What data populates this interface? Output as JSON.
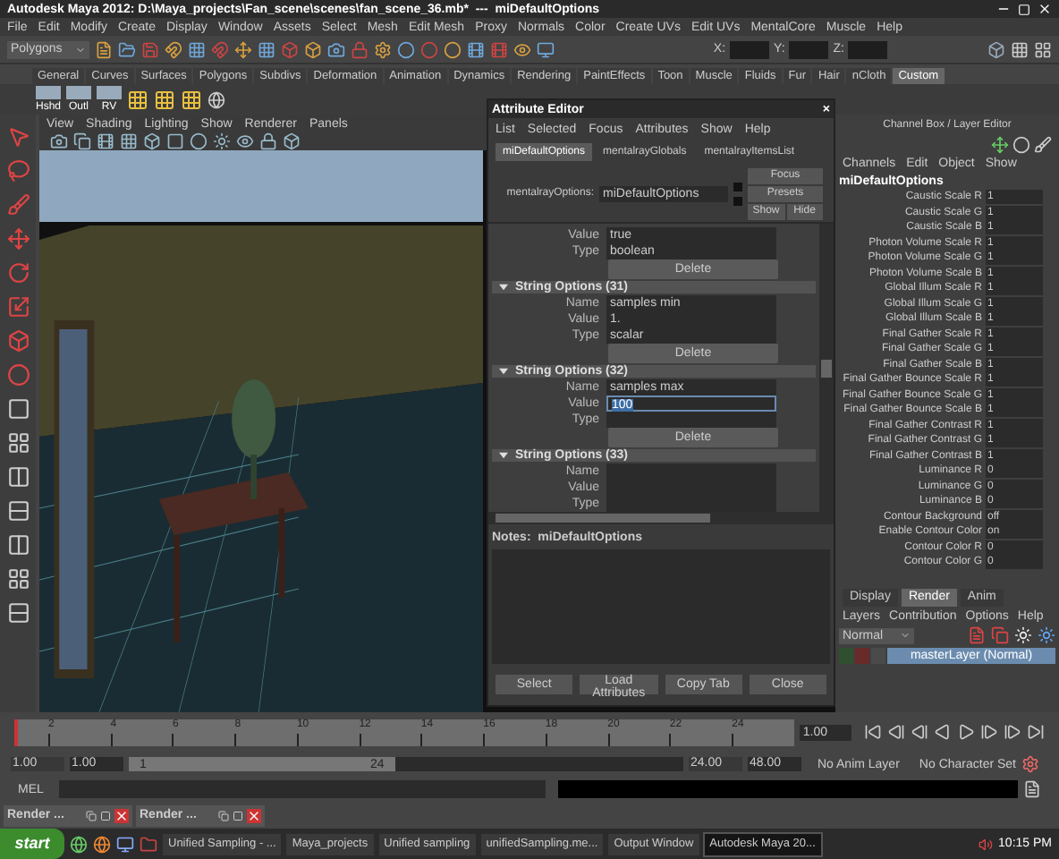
{
  "window": {
    "title": "Autodesk Maya 2012: D:\\Maya_projects\\Fan_scene\\scenes\\fan_scene_36.mb*  ---  miDefaultOptions"
  },
  "menu_bar": [
    "File",
    "Edit",
    "Modify",
    "Create",
    "Display",
    "Window",
    "Assets",
    "Select",
    "Mesh",
    "Edit Mesh",
    "Proxy",
    "Normals",
    "Color",
    "Create UVs",
    "Edit UVs",
    "MentalCore",
    "Muscle",
    "Help"
  ],
  "status_line": {
    "mode": "Polygons",
    "coord_labels": [
      "X:",
      "Y:",
      "Z:"
    ]
  },
  "shelf_tabs": [
    {
      "label": "General",
      "selected": false
    },
    {
      "label": "Curves",
      "selected": false
    },
    {
      "label": "Surfaces",
      "selected": false
    },
    {
      "label": "Polygons",
      "selected": false
    },
    {
      "label": "Subdivs",
      "selected": false
    },
    {
      "label": "Deformation",
      "selected": false
    },
    {
      "label": "Animation",
      "selected": false
    },
    {
      "label": "Dynamics",
      "selected": false
    },
    {
      "label": "Rendering",
      "selected": false
    },
    {
      "label": "PaintEffects",
      "selected": false
    },
    {
      "label": "Toon",
      "selected": false
    },
    {
      "label": "Muscle",
      "selected": false
    },
    {
      "label": "Fluids",
      "selected": false
    },
    {
      "label": "Fur",
      "selected": false
    },
    {
      "label": "Hair",
      "selected": false
    },
    {
      "label": "nCloth",
      "selected": false
    },
    {
      "label": "Custom",
      "selected": true
    }
  ],
  "shelf_buttons": [
    "Hshd",
    "Outl",
    "RV"
  ],
  "viewport": {
    "menu": [
      "View",
      "Shading",
      "Lighting",
      "Show",
      "Renderer",
      "Panels"
    ]
  },
  "attribute_editor": {
    "title": "Attribute Editor",
    "close": "×",
    "menu": [
      "List",
      "Selected",
      "Focus",
      "Attributes",
      "Show",
      "Help"
    ],
    "tabs": [
      {
        "label": "miDefaultOptions",
        "selected": true
      },
      {
        "label": "mentalrayGlobals",
        "selected": false
      },
      {
        "label": "mentalrayItemsList",
        "selected": false
      }
    ],
    "node_label": "mentalrayOptions:",
    "node_name": "miDefaultOptions",
    "side_buttons": [
      "Focus",
      "Presets",
      "Show",
      "Hide"
    ],
    "rows": [
      {
        "kind": "field",
        "label": "Value",
        "value": "true",
        "selected": false
      },
      {
        "kind": "field",
        "label": "Type",
        "value": "boolean",
        "selected": false
      },
      {
        "kind": "button",
        "label": "Delete"
      },
      {
        "kind": "header",
        "label": "String Options (31)",
        "expanded": true
      },
      {
        "kind": "field",
        "label": "Name",
        "value": "samples min",
        "selected": false
      },
      {
        "kind": "field",
        "label": "Value",
        "value": "1.",
        "selected": false
      },
      {
        "kind": "field",
        "label": "Type",
        "value": "scalar",
        "selected": false
      },
      {
        "kind": "button",
        "label": "Delete"
      },
      {
        "kind": "header",
        "label": "String Options (32)",
        "expanded": true
      },
      {
        "kind": "field",
        "label": "Name",
        "value": "samples max",
        "selected": false
      },
      {
        "kind": "field",
        "label": "Value",
        "value": "100",
        "selected": true
      },
      {
        "kind": "field",
        "label": "Type",
        "selected": false
      },
      {
        "kind": "button",
        "label": "Delete"
      },
      {
        "kind": "header",
        "label": "String Options (33)",
        "expanded": true
      },
      {
        "kind": "field",
        "label": "Name",
        "selected": false
      },
      {
        "kind": "field",
        "label": "Value",
        "selected": false
      },
      {
        "kind": "field",
        "label": "Type",
        "selected": false
      }
    ],
    "notes_label": "Notes:  miDefaultOptions",
    "buttons": [
      "Select",
      "Load Attributes",
      "Copy Tab",
      "Close"
    ]
  },
  "channel_box": {
    "title": "Channel Box / Layer Editor",
    "menu": [
      "Channels",
      "Edit",
      "Object",
      "Show"
    ],
    "node": "miDefaultOptions",
    "channels": [
      {
        "name": "Caustic Scale R",
        "value": "1"
      },
      {
        "name": "Caustic Scale G",
        "value": "1"
      },
      {
        "name": "Caustic Scale B",
        "value": "1"
      },
      {
        "name": "Photon Volume Scale R",
        "value": "1"
      },
      {
        "name": "Photon Volume Scale G",
        "value": "1"
      },
      {
        "name": "Photon Volume Scale B",
        "value": "1"
      },
      {
        "name": "Global Illum Scale R",
        "value": "1"
      },
      {
        "name": "Global Illum Scale G",
        "value": "1"
      },
      {
        "name": "Global Illum Scale B",
        "value": "1"
      },
      {
        "name": "Final Gather Scale R",
        "value": "1"
      },
      {
        "name": "Final Gather Scale G",
        "value": "1"
      },
      {
        "name": "Final Gather Scale B",
        "value": "1"
      },
      {
        "name": "Final Gather Bounce Scale R",
        "value": "1"
      },
      {
        "name": "Final Gather Bounce Scale G",
        "value": "1"
      },
      {
        "name": "Final Gather Bounce Scale B",
        "value": "1"
      },
      {
        "name": "Final Gather Contrast R",
        "value": "1"
      },
      {
        "name": "Final Gather Contrast G",
        "value": "1"
      },
      {
        "name": "Final Gather Contrast B",
        "value": "1"
      },
      {
        "name": "Luminance R",
        "value": "0"
      },
      {
        "name": "Luminance G",
        "value": "0"
      },
      {
        "name": "Luminance B",
        "value": "0"
      },
      {
        "name": "Contour Background",
        "value": "off"
      },
      {
        "name": "Enable Contour Color",
        "value": "on"
      },
      {
        "name": "Contour Color R",
        "value": "0"
      },
      {
        "name": "Contour Color G",
        "value": "0"
      }
    ],
    "layer_tabs": [
      {
        "label": "Display",
        "selected": false
      },
      {
        "label": "Render",
        "selected": true
      },
      {
        "label": "Anim",
        "selected": false
      }
    ],
    "layer_menu": [
      "Layers",
      "Contribution",
      "Options",
      "Help"
    ],
    "blend_mode": "Normal",
    "layers": [
      {
        "name": "masterLayer (Normal)",
        "selected": true
      }
    ]
  },
  "timeline": {
    "level": 0,
    "ticks": [
      "2",
      "4",
      "6",
      "8",
      "10",
      "12",
      "14",
      "16",
      "18",
      "20",
      "22",
      "24"
    ],
    "current_frame": "1.00"
  },
  "range": {
    "level": 0.48,
    "start": "1.00",
    "playback_start": "1.00",
    "slider_start": "1",
    "slider_end": "24",
    "playback_end": "24.00",
    "end": "48.00",
    "anim_layer": "No Anim Layer",
    "character_set": "No Character Set"
  },
  "command_line": {
    "label": "MEL"
  },
  "minimized_windows": [
    "Render ...",
    "Render ..."
  ],
  "taskbar": {
    "start": "start",
    "tasks": [
      {
        "label": "Unified Sampling - ...",
        "selected": false
      },
      {
        "label": "Maya_projects",
        "selected": false
      },
      {
        "label": "Unified sampling",
        "selected": false
      },
      {
        "label": "unifiedSampling.me...",
        "selected": false
      },
      {
        "label": "Output Window",
        "selected": false
      },
      {
        "label": "Autodesk Maya 20...",
        "selected": true
      }
    ],
    "clock": "10:15 PM"
  }
}
